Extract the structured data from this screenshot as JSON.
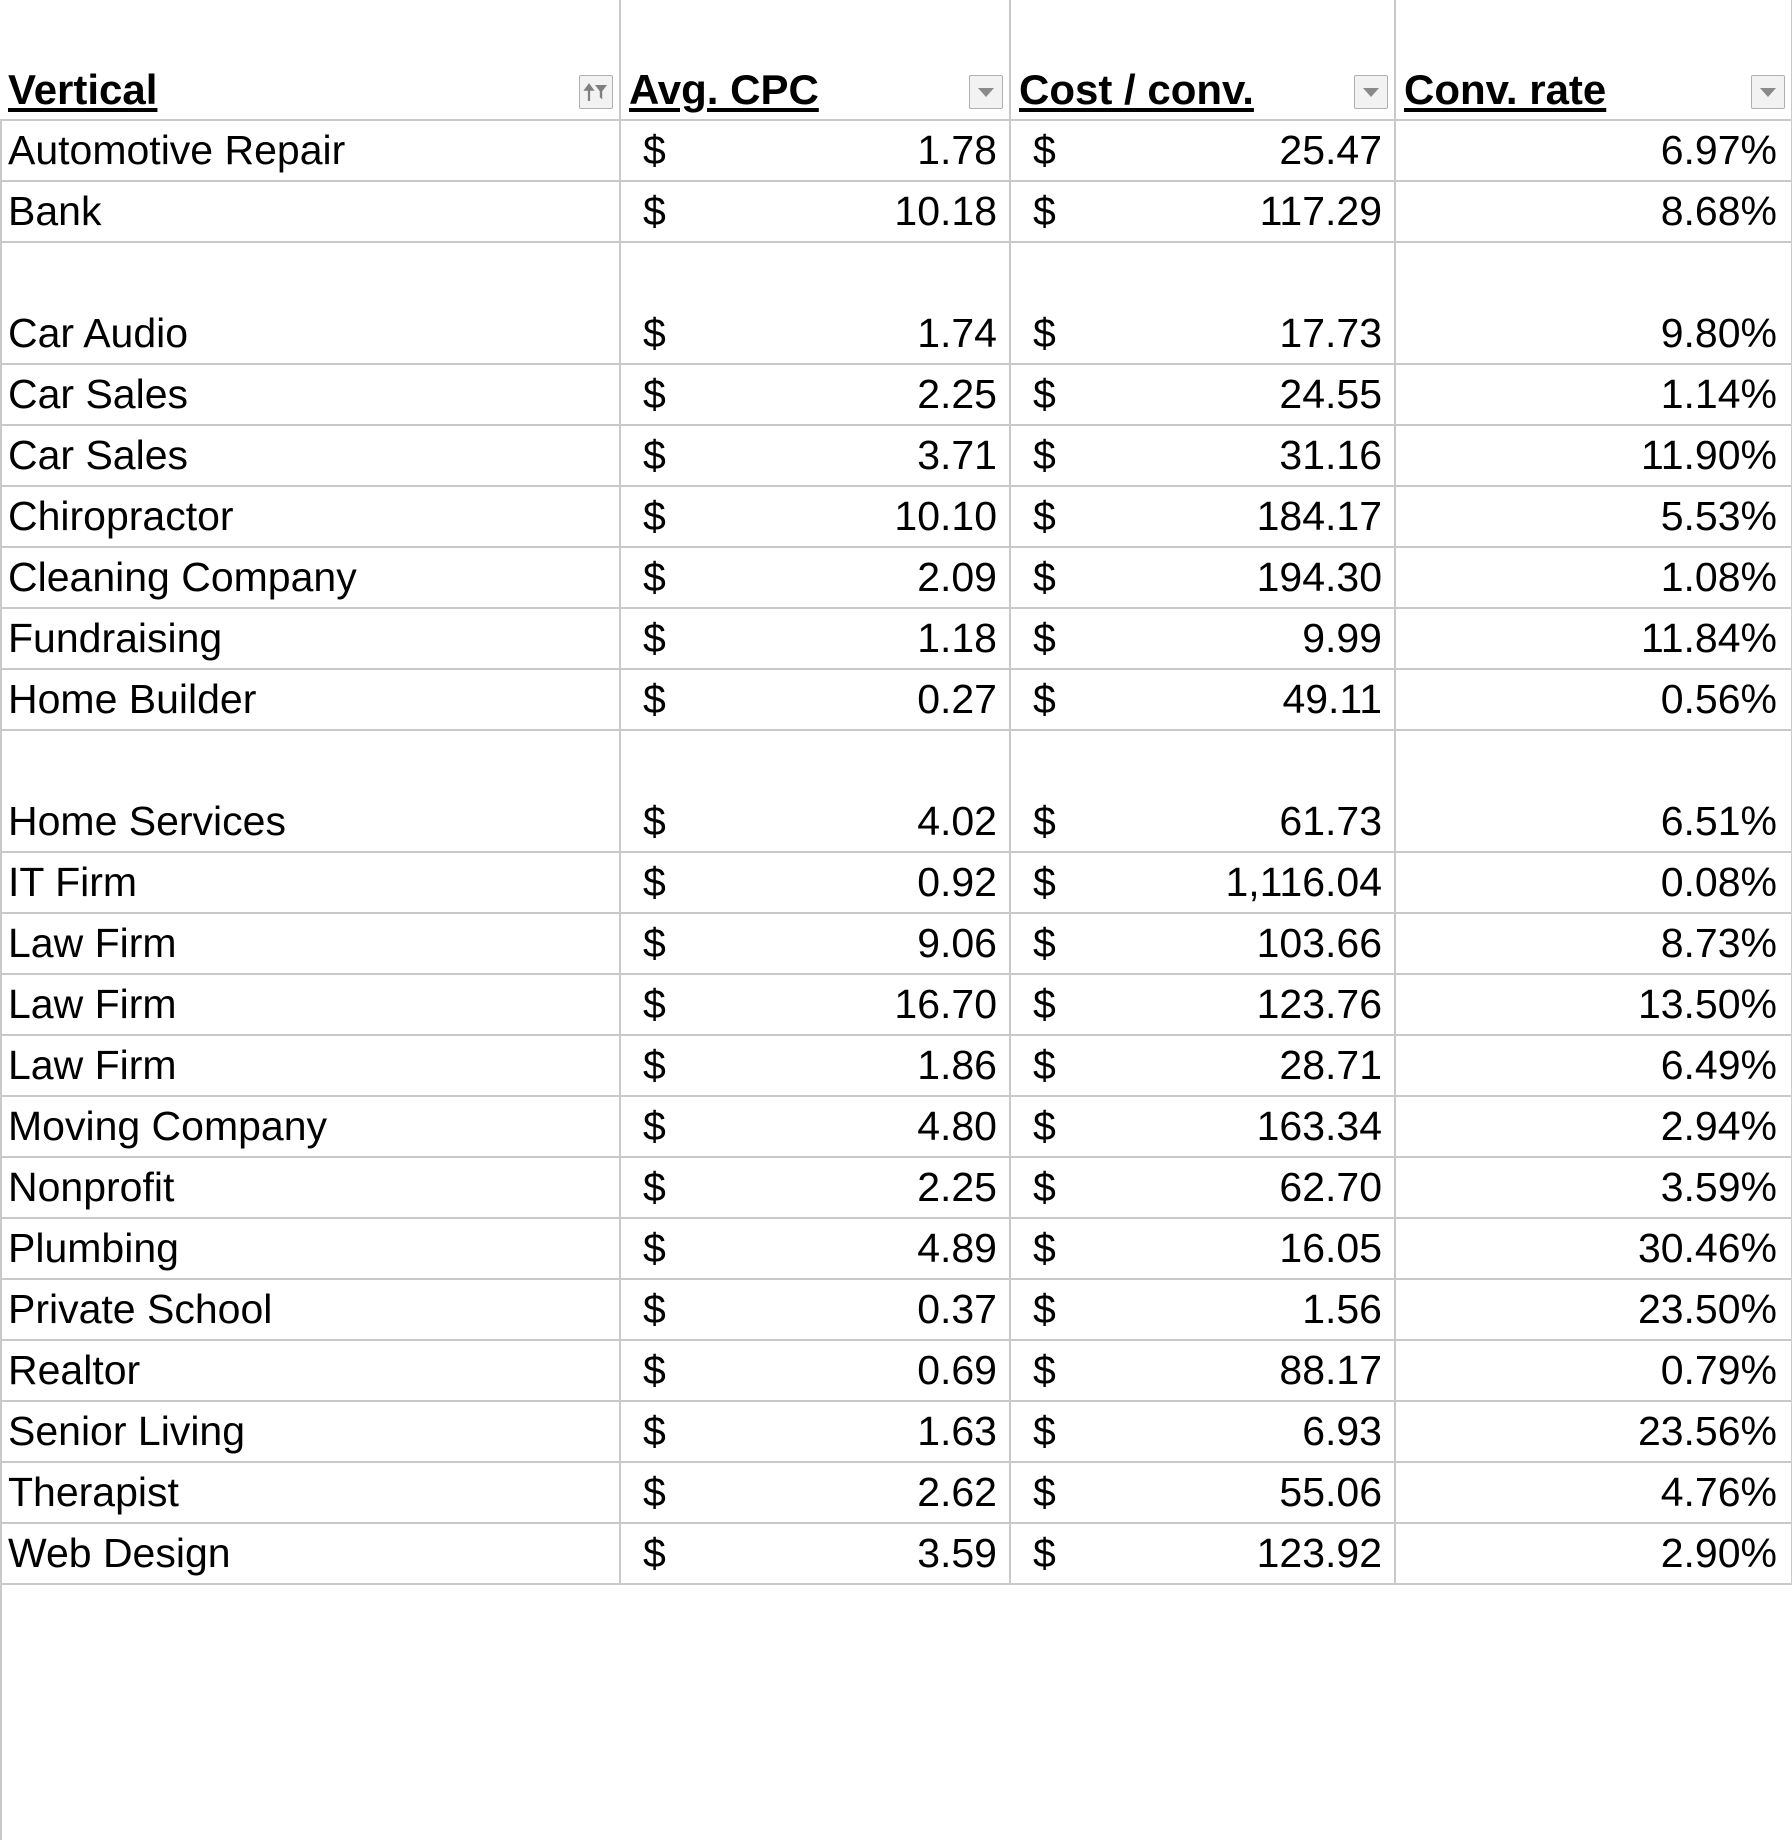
{
  "spreadsheet": {
    "columns": [
      {
        "key": "vertical",
        "label": "Vertical",
        "filter_icon": "sort-filter-icon",
        "align": "left"
      },
      {
        "key": "cpc",
        "label": "Avg. CPC",
        "filter_icon": "chevron-down-icon",
        "align": "right"
      },
      {
        "key": "cost",
        "label": "Cost / conv.",
        "filter_icon": "chevron-down-icon",
        "align": "right"
      },
      {
        "key": "rate",
        "label": "Conv. rate",
        "filter_icon": "chevron-down-icon",
        "align": "right"
      }
    ],
    "currency_symbol": "$",
    "rows": [
      {
        "vertical": "Automotive Repair",
        "cpc": "1.78",
        "cost": "25.47",
        "rate": "6.97%",
        "tall": false
      },
      {
        "vertical": "Bank",
        "cpc": "10.18",
        "cost": "117.29",
        "rate": "8.68%",
        "tall": false
      },
      {
        "vertical": "Car Audio",
        "cpc": "1.74",
        "cost": "17.73",
        "rate": "9.80%",
        "tall": true
      },
      {
        "vertical": "Car Sales",
        "cpc": "2.25",
        "cost": "24.55",
        "rate": "1.14%",
        "tall": false
      },
      {
        "vertical": "Car Sales",
        "cpc": "3.71",
        "cost": "31.16",
        "rate": "11.90%",
        "tall": false
      },
      {
        "vertical": "Chiropractor",
        "cpc": "10.10",
        "cost": "184.17",
        "rate": "5.53%",
        "tall": false
      },
      {
        "vertical": "Cleaning Company",
        "cpc": "2.09",
        "cost": "194.30",
        "rate": "1.08%",
        "tall": false
      },
      {
        "vertical": "Fundraising",
        "cpc": "1.18",
        "cost": "9.99",
        "rate": "11.84%",
        "tall": false
      },
      {
        "vertical": "Home Builder",
        "cpc": "0.27",
        "cost": "49.11",
        "rate": "0.56%",
        "tall": false
      },
      {
        "vertical": "Home Services",
        "cpc": "4.02",
        "cost": "61.73",
        "rate": "6.51%",
        "tall": true
      },
      {
        "vertical": "IT Firm",
        "cpc": "0.92",
        "cost": "1,116.04",
        "rate": "0.08%",
        "tall": false
      },
      {
        "vertical": "Law Firm",
        "cpc": "9.06",
        "cost": "103.66",
        "rate": "8.73%",
        "tall": false
      },
      {
        "vertical": "Law Firm",
        "cpc": "16.70",
        "cost": "123.76",
        "rate": "13.50%",
        "tall": false
      },
      {
        "vertical": "Law Firm",
        "cpc": "1.86",
        "cost": "28.71",
        "rate": "6.49%",
        "tall": false
      },
      {
        "vertical": "Moving Company",
        "cpc": "4.80",
        "cost": "163.34",
        "rate": "2.94%",
        "tall": false
      },
      {
        "vertical": "Nonprofit",
        "cpc": "2.25",
        "cost": "62.70",
        "rate": "3.59%",
        "tall": false
      },
      {
        "vertical": "Plumbing",
        "cpc": "4.89",
        "cost": "16.05",
        "rate": "30.46%",
        "tall": false
      },
      {
        "vertical": "Private School",
        "cpc": "0.37",
        "cost": "1.56",
        "rate": "23.50%",
        "tall": false
      },
      {
        "vertical": "Realtor",
        "cpc": "0.69",
        "cost": "88.17",
        "rate": "0.79%",
        "tall": false
      },
      {
        "vertical": "Senior Living",
        "cpc": "1.63",
        "cost": "6.93",
        "rate": "23.56%",
        "tall": false
      },
      {
        "vertical": "Therapist",
        "cpc": "2.62",
        "cost": "55.06",
        "rate": "4.76%",
        "tall": false
      },
      {
        "vertical": "Web Design",
        "cpc": "3.59",
        "cost": "123.92",
        "rate": "2.90%",
        "tall": false
      }
    ]
  },
  "colors": {
    "gridline": "#c9c9c9",
    "text": "#000000",
    "background": "#ffffff",
    "filter_button_fill": "#f2f2f2",
    "filter_button_border": "#b0b0b0",
    "filter_glyph": "#7f7f7f"
  }
}
